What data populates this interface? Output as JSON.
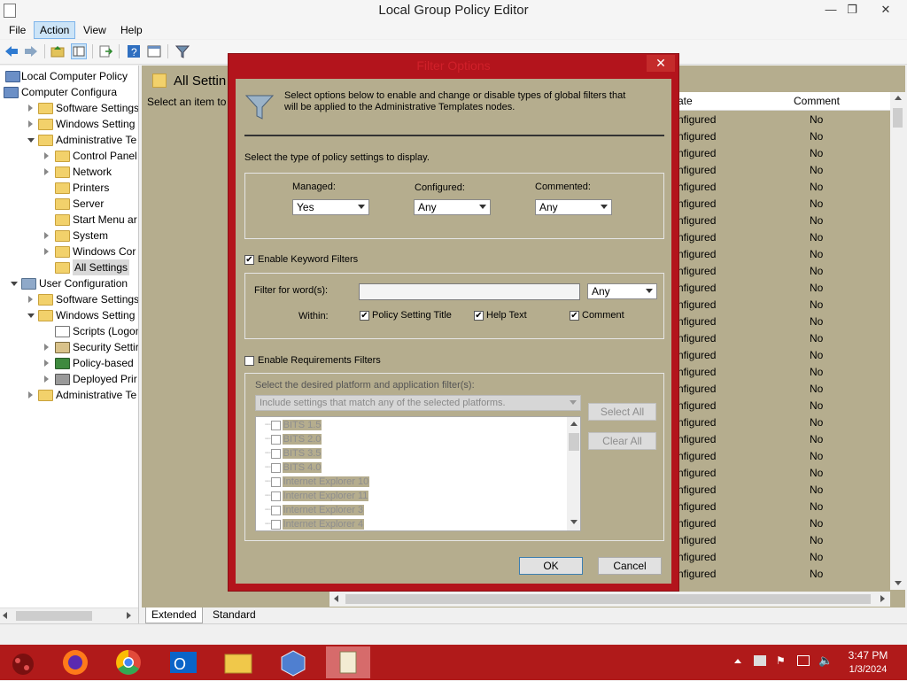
{
  "window": {
    "title": "Local Group Policy Editor"
  },
  "menubar": [
    "File",
    "Action",
    "View",
    "Help"
  ],
  "tree": {
    "items": [
      {
        "label": "Local Computer Policy"
      },
      {
        "label": "Computer Configura"
      },
      {
        "label": "Software Settings"
      },
      {
        "label": "Windows Setting"
      },
      {
        "label": "Administrative Te"
      },
      {
        "label": "Control Panel"
      },
      {
        "label": "Network"
      },
      {
        "label": "Printers"
      },
      {
        "label": "Server"
      },
      {
        "label": "Start Menu ar"
      },
      {
        "label": "System"
      },
      {
        "label": "Windows Cor"
      },
      {
        "label": "All Settings"
      },
      {
        "label": "User Configuration"
      },
      {
        "label": "Software Settings"
      },
      {
        "label": "Windows Setting"
      },
      {
        "label": "Scripts (Logon"
      },
      {
        "label": "Security Settir"
      },
      {
        "label": "Policy-based"
      },
      {
        "label": "Deployed Prir"
      },
      {
        "label": "Administrative Te"
      }
    ]
  },
  "main": {
    "heading": "All Settin",
    "hint": "Select an item to",
    "columns": {
      "state": "ate",
      "comment": "Comment"
    },
    "rows_state": "nfigured",
    "rows_comment": "No",
    "row_count": 28
  },
  "tabs": {
    "extended": "Extended",
    "standard": "Standard"
  },
  "dialog": {
    "title": "Filter Options",
    "intro": "Select options below to enable and change or disable types of global filters that will be applied to the Administrative Templates nodes.",
    "type_label": "Select the type of policy settings to display.",
    "managed_label": "Managed:",
    "managed_value": "Yes",
    "configured_label": "Configured:",
    "configured_value": "Any",
    "commented_label": "Commented:",
    "commented_value": "Any",
    "keyword_label": "Enable Keyword Filters",
    "keyword_checked": true,
    "filter_words_label": "Filter for word(s):",
    "filter_words_value": "",
    "filter_match_value": "Any",
    "within_label": "Within:",
    "within_title": "Policy Setting Title",
    "within_help": "Help Text",
    "within_comment": "Comment",
    "requirements_label": "Enable Requirements Filters",
    "requirements_checked": false,
    "platform_label": "Select the desired platform and application filter(s):",
    "platform_mode": "Include settings that match any of the selected platforms.",
    "select_all": "Select All",
    "clear_all": "Clear All",
    "platforms": [
      "BITS 1.5",
      "BITS 2.0",
      "BITS 3.5",
      "BITS 4.0",
      "Internet Explorer 10",
      "Internet Explorer 11",
      "Internet Explorer 3",
      "Internet Explorer 4"
    ],
    "ok": "OK",
    "cancel": "Cancel"
  },
  "taskbar": {
    "time": "3:47 PM",
    "date": "1/3/2024"
  },
  "colors": {
    "dialog_border": "#b3141c",
    "taskbar": "#b01a1a",
    "pane_bg": "#b5ad8e"
  }
}
